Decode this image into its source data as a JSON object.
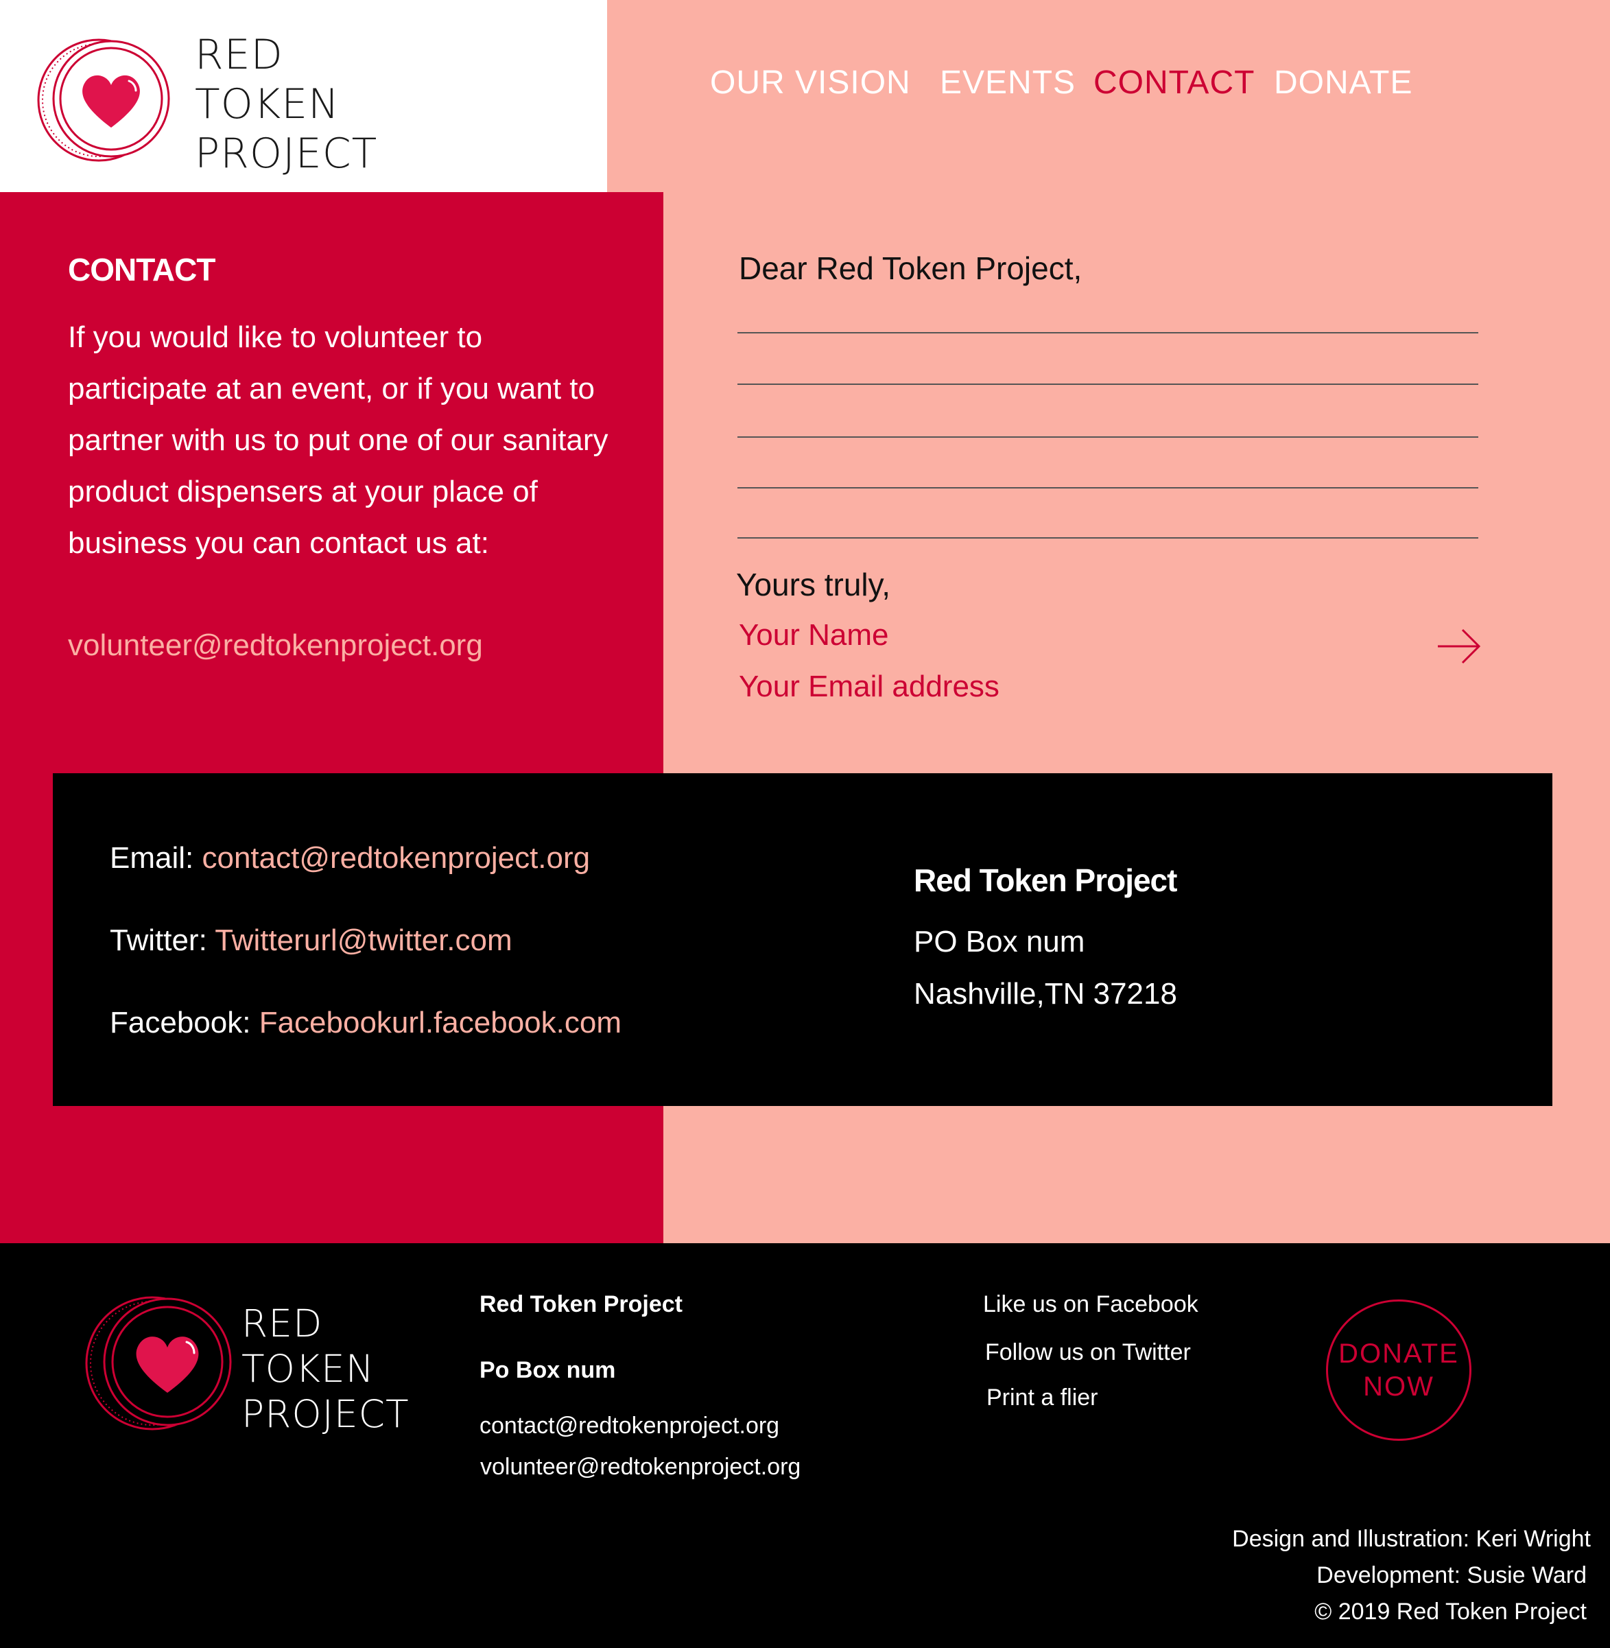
{
  "brand": {
    "line1": "RED",
    "line2": "TOKEN",
    "line3": "PROJECT"
  },
  "nav": {
    "items": [
      {
        "label": "OUR VISION"
      },
      {
        "label": "EVENTS"
      },
      {
        "label": "CONTACT"
      },
      {
        "label": "DONATE"
      }
    ],
    "active": "CONTACT"
  },
  "contact": {
    "heading": "CONTACT",
    "intro": "If you would like to volunteer to participate at  an event, or if you want to partner with us to put one of our sanitary product dispensers at your place of business you can contact us at:",
    "email": "volunteer@redtokenproject.org"
  },
  "letter": {
    "greeting": "Dear Red Token Project,",
    "closing": "Yours truly,",
    "name_placeholder": "Your Name",
    "email_placeholder": "Your Email address",
    "submit_icon": "arrow-right-icon"
  },
  "info": {
    "email_label": "Email:",
    "email_value": "contact@redtokenproject.org",
    "twitter_label": "Twitter:",
    "twitter_value": "Twitterurl@twitter.com",
    "facebook_label": "Facebook:",
    "facebook_value": "Facebookurl.facebook.com",
    "org_name": "Red Token Project",
    "po_box": "PO Box num",
    "city": "Nashville,TN 37218"
  },
  "footer": {
    "org_name": "Red Token Project",
    "po_box": "Po Box num",
    "contact_email": "contact@redtokenproject.org",
    "volunteer_email": "volunteer@redtokenproject.org",
    "facebook_link": "Like us on Facebook",
    "twitter_link": "Follow us on Twitter",
    "flier_link": "Print a flier",
    "donate_line1": "DONATE",
    "donate_line2": "NOW",
    "credit_design": "Design and Illustration: Keri Wright",
    "credit_dev": "Development: Susie Ward",
    "copyright": "© 2019 Red Token Project"
  },
  "colors": {
    "brand_red": "#cc0033",
    "salmon": "#fbb0a4",
    "black": "#000000",
    "white": "#ffffff"
  }
}
